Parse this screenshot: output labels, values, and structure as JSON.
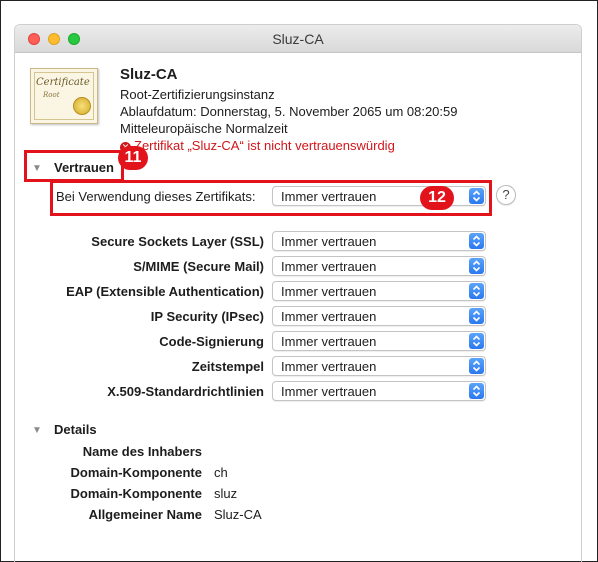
{
  "window": {
    "title": "Sluz-CA"
  },
  "cert": {
    "name": "Sluz-CA",
    "type": "Root-Zertifizierungsinstanz",
    "expiry_line1": "Ablaufdatum: Donnerstag, 5. November 2065 um 08:20:59",
    "expiry_line2": "Mitteleuropäische Normalzeit",
    "warning": "Zertifikat „Sluz-CA“ ist nicht vertrauenswürdig",
    "icon_text": "Certificate",
    "icon_sub": "Root"
  },
  "annotations": {
    "badge_11": "11",
    "badge_12": "12"
  },
  "colors": {
    "warning": "#d0161b",
    "highlight": "#e3131c",
    "accent": "#2a78f0"
  },
  "trust": {
    "section_title": "Vertrauen",
    "when_using_label": "Bei Verwendung dieses Zertifikats:",
    "when_using_value": "Immer vertrauen",
    "help": "?",
    "policies": [
      {
        "label": "Secure Sockets Layer (SSL)",
        "value": "Immer vertrauen"
      },
      {
        "label": "S/MIME (Secure Mail)",
        "value": "Immer vertrauen"
      },
      {
        "label": "EAP (Extensible Authentication)",
        "value": "Immer vertrauen"
      },
      {
        "label": "IP Security (IPsec)",
        "value": "Immer vertrauen"
      },
      {
        "label": "Code-Signierung",
        "value": "Immer vertrauen"
      },
      {
        "label": "Zeitstempel",
        "value": "Immer vertrauen"
      },
      {
        "label": "X.509-Standardrichtlinien",
        "value": "Immer vertrauen"
      }
    ]
  },
  "details": {
    "section_title": "Details",
    "subject_heading": "Name des Inhabers",
    "rows": [
      {
        "label": "Domain-Komponente",
        "value": "ch"
      },
      {
        "label": "Domain-Komponente",
        "value": "sluz"
      },
      {
        "label": "Allgemeiner Name",
        "value": "Sluz-CA"
      }
    ]
  }
}
